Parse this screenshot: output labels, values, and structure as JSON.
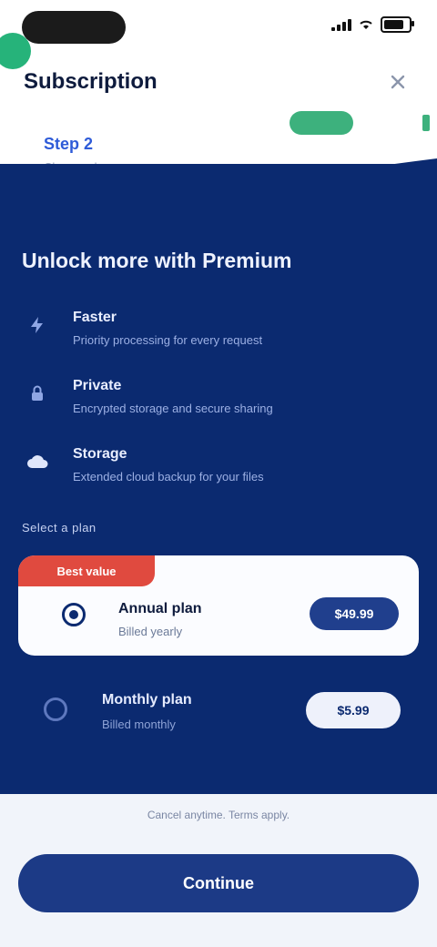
{
  "header": {
    "title": "Subscription"
  },
  "progress": {
    "step_label": "Step 2",
    "step_sub": "Choose plan"
  },
  "card": {
    "title": "Unlock more with Premium",
    "features": [
      {
        "icon": "bolt-icon",
        "title": "Faster",
        "subtitle": "Priority processing for every request"
      },
      {
        "icon": "lock-icon",
        "title": "Private",
        "subtitle": "Encrypted storage and secure sharing"
      },
      {
        "icon": "cloud-icon",
        "title": "Storage",
        "subtitle": "Extended cloud backup for your files"
      }
    ],
    "section_label": "Select a plan"
  },
  "offer": {
    "badge": "Best value",
    "name": "Annual plan",
    "subtitle": "Billed yearly",
    "price": "$49.99"
  },
  "alt_plan": {
    "name": "Monthly plan",
    "subtitle": "Billed monthly",
    "price": "$5.99"
  },
  "footer": {
    "fine_print": "Cancel anytime. Terms apply.",
    "cta_label": "Continue"
  },
  "colors": {
    "navy": "#0b2a70",
    "accent_green": "#26b37a",
    "badge_red": "#e04a3f",
    "cta": "#1c3a86"
  }
}
